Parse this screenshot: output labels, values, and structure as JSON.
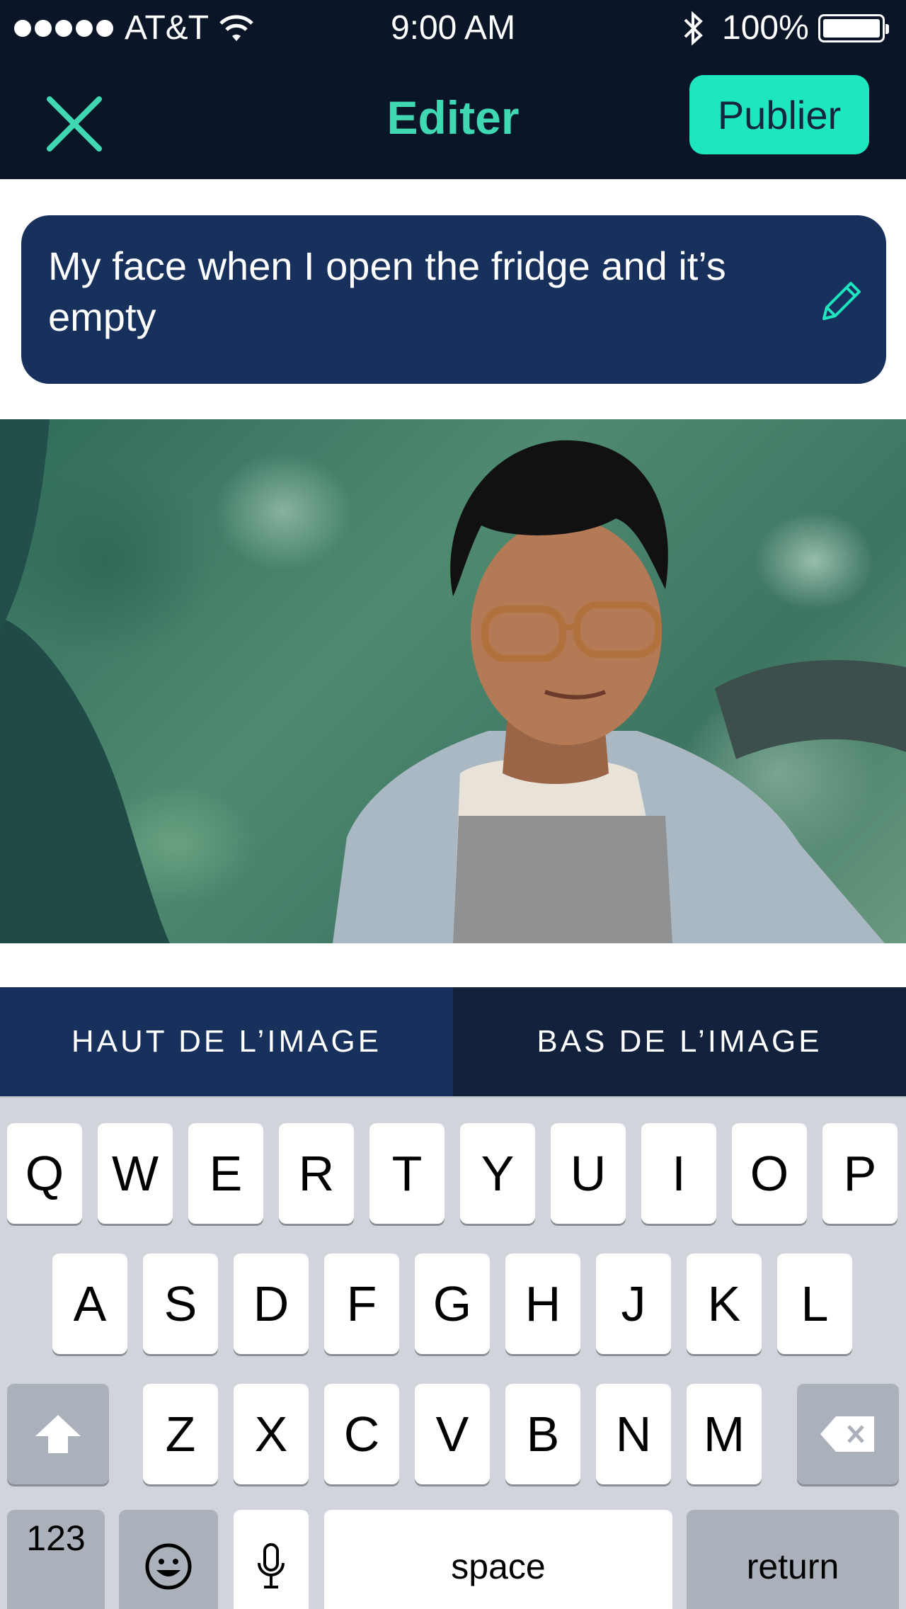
{
  "status_bar": {
    "carrier": "AT&T",
    "time": "9:00 AM",
    "battery": "100%"
  },
  "nav": {
    "title": "Editer",
    "publish_label": "Publier",
    "close_icon": "close-x-icon"
  },
  "caption": {
    "text": "My face when I open the fridge and it’s empty",
    "edit_icon": "pencil-icon"
  },
  "photo": {
    "description_icon": "photo"
  },
  "tabs": [
    {
      "label": "HAUT DE L’IMAGE",
      "active": true
    },
    {
      "label": "BAS DE L’IMAGE",
      "active": false
    }
  ],
  "keyboard": {
    "row1": [
      "Q",
      "W",
      "E",
      "R",
      "T",
      "Y",
      "U",
      "I",
      "O",
      "P"
    ],
    "row2": [
      "A",
      "S",
      "D",
      "F",
      "G",
      "H",
      "J",
      "K",
      "L"
    ],
    "row3": [
      "Z",
      "X",
      "C",
      "V",
      "B",
      "N",
      "M"
    ],
    "numbers_label": "123",
    "space_label": "space",
    "return_label": "return",
    "shift_icon": "shift-icon",
    "delete_icon": "delete-icon",
    "emoji_icon": "emoji-icon",
    "mic_icon": "microphone-icon"
  },
  "colors": {
    "nav_bg": "#0b1528",
    "accent": "#1ee6bf",
    "title": "#3fd8b2",
    "card": "#17305c"
  }
}
